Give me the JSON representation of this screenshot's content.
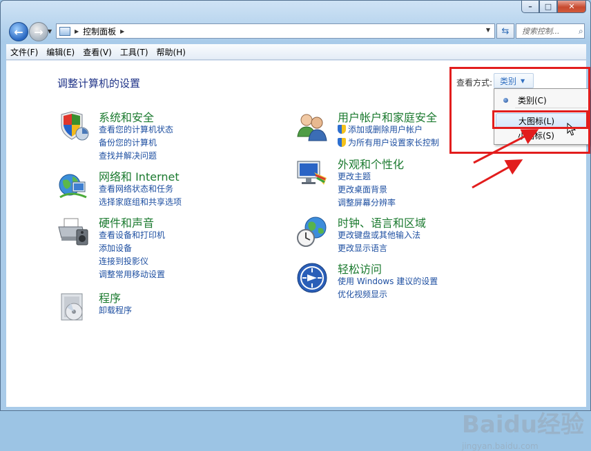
{
  "window": {
    "caption_buttons": [
      "–",
      "□",
      "✕"
    ]
  },
  "nav": {
    "breadcrumb": "控制面板",
    "search_placeholder": "搜索控制..."
  },
  "menu": [
    "文件(F)",
    "编辑(E)",
    "查看(V)",
    "工具(T)",
    "帮助(H)"
  ],
  "page": {
    "title": "调整计算机的设置",
    "view_by_label": "查看方式:",
    "view_by_value": "类别"
  },
  "view_menu": {
    "items": [
      {
        "label": "类别(C)",
        "selected": true
      },
      {
        "label": "大图标(L)",
        "highlighted": true
      },
      {
        "label": "小图标(S)"
      }
    ]
  },
  "categories_left": [
    {
      "title": "系统和安全",
      "icon": "shield-icon",
      "links": [
        "查看您的计算机状态",
        "备份您的计算机",
        "查找并解决问题"
      ]
    },
    {
      "title": "网络和 Internet",
      "icon": "network-globe-icon",
      "links": [
        "查看网络状态和任务",
        "选择家庭组和共享选项"
      ]
    },
    {
      "title": "硬件和声音",
      "icon": "printer-icon",
      "links": [
        "查看设备和打印机",
        "添加设备",
        "连接到投影仪",
        "调整常用移动设置"
      ]
    },
    {
      "title": "程序",
      "icon": "program-disc-icon",
      "links": [
        "卸载程序"
      ]
    }
  ],
  "categories_right": [
    {
      "title": "用户帐户和家庭安全",
      "icon": "users-icon",
      "links": [
        "添加或删除用户帐户",
        "为所有用户设置家长控制"
      ]
    },
    {
      "title": "外观和个性化",
      "icon": "monitor-palette-icon",
      "links": [
        "更改主题",
        "更改桌面背景",
        "调整屏幕分辨率"
      ]
    },
    {
      "title": "时钟、语言和区域",
      "icon": "clock-globe-icon",
      "links": [
        "更改键盘或其他输入法",
        "更改显示语言"
      ]
    },
    {
      "title": "轻松访问",
      "icon": "ease-of-access-icon",
      "links": [
        "使用 Windows 建议的设置",
        "优化视频显示"
      ]
    }
  ],
  "watermark": {
    "text": "Baidu经验",
    "sub": "jingyan.baidu.com"
  },
  "colors": {
    "link": "#1e4fa1",
    "category_title": "#1b7a2f",
    "annotation_red": "#e21d1d"
  }
}
